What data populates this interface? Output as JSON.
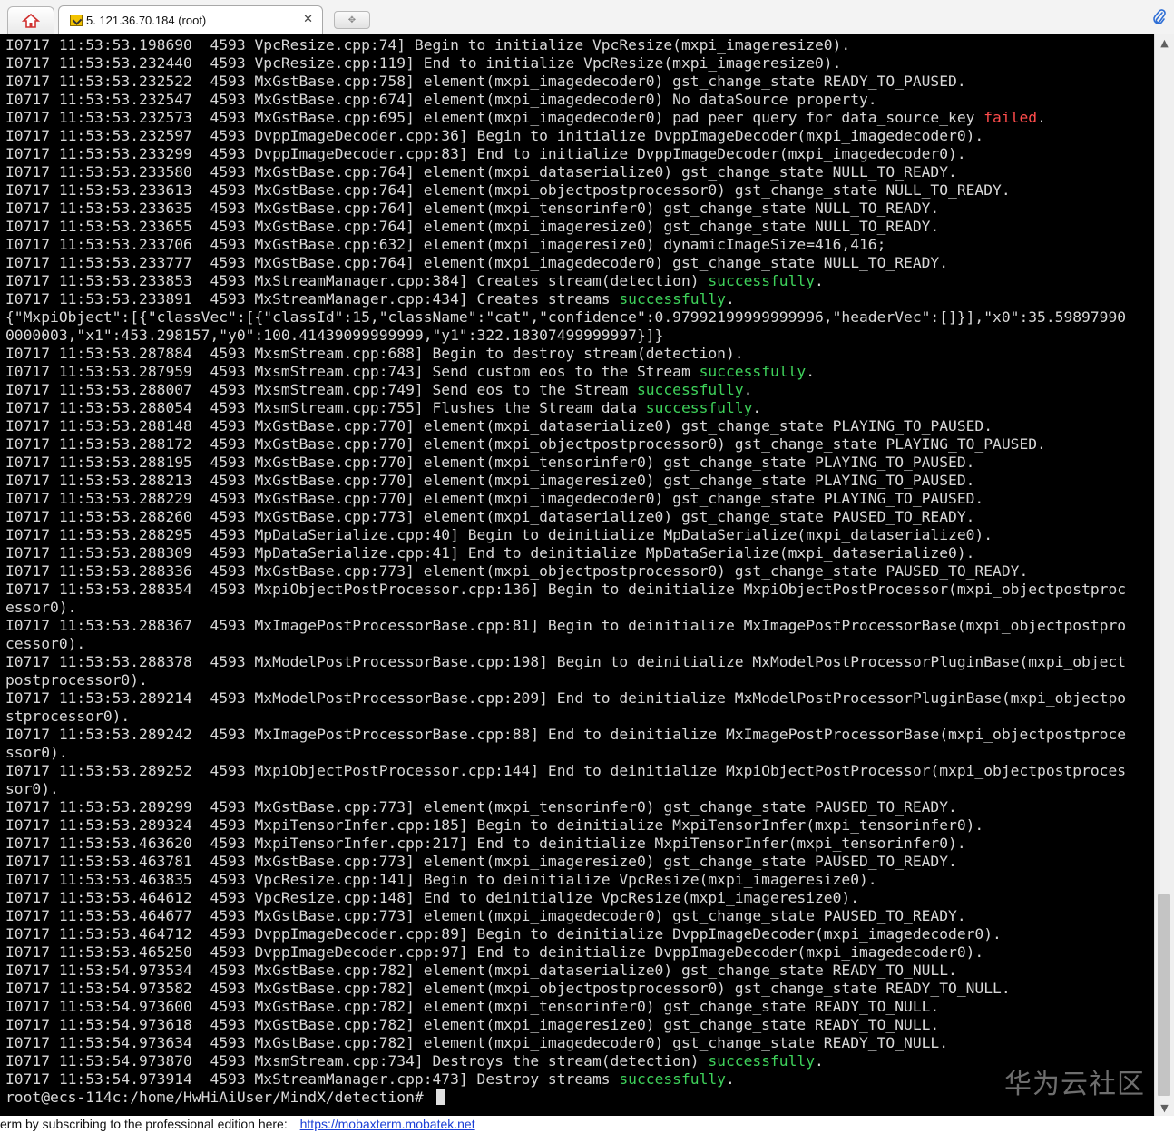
{
  "tabs": {
    "home_icon": "home-icon",
    "session_title": "5. 121.36.70.184 (root)",
    "close_glyph": "✕",
    "new_tab_glyph": "✥",
    "attach_icon": "paperclip-icon"
  },
  "terminal": {
    "lines": [
      [
        {
          "t": "I0717 11:53:53.198690  4593 VpcResize.cpp:74] Begin to initialize VpcResize(mxpi_imageresize0)."
        }
      ],
      [
        {
          "t": "I0717 11:53:53.232440  4593 VpcResize.cpp:119] End to initialize VpcResize(mxpi_imageresize0)."
        }
      ],
      [
        {
          "t": "I0717 11:53:53.232522  4593 MxGstBase.cpp:758] element(mxpi_imagedecoder0) gst_change_state READY_TO_PAUSED."
        }
      ],
      [
        {
          "t": "I0717 11:53:53.232547  4593 MxGstBase.cpp:674] element(mxpi_imagedecoder0) No dataSource property."
        }
      ],
      [
        {
          "t": "I0717 11:53:53.232573  4593 MxGstBase.cpp:695] element(mxpi_imagedecoder0) pad peer query for data_source_key "
        },
        {
          "t": "failed",
          "c": "red"
        },
        {
          "t": "."
        }
      ],
      [
        {
          "t": "I0717 11:53:53.232597  4593 DvppImageDecoder.cpp:36] Begin to initialize DvppImageDecoder(mxpi_imagedecoder0)."
        }
      ],
      [
        {
          "t": "I0717 11:53:53.233299  4593 DvppImageDecoder.cpp:83] End to initialize DvppImageDecoder(mxpi_imagedecoder0)."
        }
      ],
      [
        {
          "t": "I0717 11:53:53.233580  4593 MxGstBase.cpp:764] element(mxpi_dataserialize0) gst_change_state NULL_TO_READY."
        }
      ],
      [
        {
          "t": "I0717 11:53:53.233613  4593 MxGstBase.cpp:764] element(mxpi_objectpostprocessor0) gst_change_state NULL_TO_READY."
        }
      ],
      [
        {
          "t": "I0717 11:53:53.233635  4593 MxGstBase.cpp:764] element(mxpi_tensorinfer0) gst_change_state NULL_TO_READY."
        }
      ],
      [
        {
          "t": "I0717 11:53:53.233655  4593 MxGstBase.cpp:764] element(mxpi_imageresize0) gst_change_state NULL_TO_READY."
        }
      ],
      [
        {
          "t": "I0717 11:53:53.233706  4593 MxGstBase.cpp:632] element(mxpi_imageresize0) dynamicImageSize=416,416;"
        }
      ],
      [
        {
          "t": "I0717 11:53:53.233777  4593 MxGstBase.cpp:764] element(mxpi_imagedecoder0) gst_change_state NULL_TO_READY."
        }
      ],
      [
        {
          "t": "I0717 11:53:53.233853  4593 MxStreamManager.cpp:384] Creates stream(detection) "
        },
        {
          "t": "successfully",
          "c": "green"
        },
        {
          "t": "."
        }
      ],
      [
        {
          "t": "I0717 11:53:53.233891  4593 MxStreamManager.cpp:434] Creates streams "
        },
        {
          "t": "successfully",
          "c": "green"
        },
        {
          "t": "."
        }
      ],
      [
        {
          "t": "{\"MxpiObject\":[{\"classVec\":[{\"classId\":15,\"className\":\"cat\",\"confidence\":0.97992199999999996,\"headerVec\":[]}],\"x0\":35.59897990"
        }
      ],
      [
        {
          "t": "0000003,\"x1\":453.298157,\"y0\":100.41439099999999,\"y1\":322.18307499999997}]}"
        }
      ],
      [
        {
          "t": "I0717 11:53:53.287884  4593 MxsmStream.cpp:688] Begin to destroy stream(detection)."
        }
      ],
      [
        {
          "t": "I0717 11:53:53.287959  4593 MxsmStream.cpp:743] Send custom eos to the Stream "
        },
        {
          "t": "successfully",
          "c": "green"
        },
        {
          "t": "."
        }
      ],
      [
        {
          "t": "I0717 11:53:53.288007  4593 MxsmStream.cpp:749] Send eos to the Stream "
        },
        {
          "t": "successfully",
          "c": "green"
        },
        {
          "t": "."
        }
      ],
      [
        {
          "t": "I0717 11:53:53.288054  4593 MxsmStream.cpp:755] Flushes the Stream data "
        },
        {
          "t": "successfully",
          "c": "green"
        },
        {
          "t": "."
        }
      ],
      [
        {
          "t": "I0717 11:53:53.288148  4593 MxGstBase.cpp:770] element(mxpi_dataserialize0) gst_change_state PLAYING_TO_PAUSED."
        }
      ],
      [
        {
          "t": "I0717 11:53:53.288172  4593 MxGstBase.cpp:770] element(mxpi_objectpostprocessor0) gst_change_state PLAYING_TO_PAUSED."
        }
      ],
      [
        {
          "t": "I0717 11:53:53.288195  4593 MxGstBase.cpp:770] element(mxpi_tensorinfer0) gst_change_state PLAYING_TO_PAUSED."
        }
      ],
      [
        {
          "t": "I0717 11:53:53.288213  4593 MxGstBase.cpp:770] element(mxpi_imageresize0) gst_change_state PLAYING_TO_PAUSED."
        }
      ],
      [
        {
          "t": "I0717 11:53:53.288229  4593 MxGstBase.cpp:770] element(mxpi_imagedecoder0) gst_change_state PLAYING_TO_PAUSED."
        }
      ],
      [
        {
          "t": "I0717 11:53:53.288260  4593 MxGstBase.cpp:773] element(mxpi_dataserialize0) gst_change_state PAUSED_TO_READY."
        }
      ],
      [
        {
          "t": "I0717 11:53:53.288295  4593 MpDataSerialize.cpp:40] Begin to deinitialize MpDataSerialize(mxpi_dataserialize0)."
        }
      ],
      [
        {
          "t": "I0717 11:53:53.288309  4593 MpDataSerialize.cpp:41] End to deinitialize MpDataSerialize(mxpi_dataserialize0)."
        }
      ],
      [
        {
          "t": "I0717 11:53:53.288336  4593 MxGstBase.cpp:773] element(mxpi_objectpostprocessor0) gst_change_state PAUSED_TO_READY."
        }
      ],
      [
        {
          "t": "I0717 11:53:53.288354  4593 MxpiObjectPostProcessor.cpp:136] Begin to deinitialize MxpiObjectPostProcessor(mxpi_objectpostproc"
        }
      ],
      [
        {
          "t": "essor0)."
        }
      ],
      [
        {
          "t": "I0717 11:53:53.288367  4593 MxImagePostProcessorBase.cpp:81] Begin to deinitialize MxImagePostProcessorBase(mxpi_objectpostpro"
        }
      ],
      [
        {
          "t": "cessor0)."
        }
      ],
      [
        {
          "t": "I0717 11:53:53.288378  4593 MxModelPostProcessorBase.cpp:198] Begin to deinitialize MxModelPostProcessorPluginBase(mxpi_object"
        }
      ],
      [
        {
          "t": "postprocessor0)."
        }
      ],
      [
        {
          "t": "I0717 11:53:53.289214  4593 MxModelPostProcessorBase.cpp:209] End to deinitialize MxModelPostProcessorPluginBase(mxpi_objectpo"
        }
      ],
      [
        {
          "t": "stprocessor0)."
        }
      ],
      [
        {
          "t": "I0717 11:53:53.289242  4593 MxImagePostProcessorBase.cpp:88] End to deinitialize MxImagePostProcessorBase(mxpi_objectpostproce"
        }
      ],
      [
        {
          "t": "ssor0)."
        }
      ],
      [
        {
          "t": "I0717 11:53:53.289252  4593 MxpiObjectPostProcessor.cpp:144] End to deinitialize MxpiObjectPostProcessor(mxpi_objectpostproces"
        }
      ],
      [
        {
          "t": "sor0)."
        }
      ],
      [
        {
          "t": "I0717 11:53:53.289299  4593 MxGstBase.cpp:773] element(mxpi_tensorinfer0) gst_change_state PAUSED_TO_READY."
        }
      ],
      [
        {
          "t": "I0717 11:53:53.289324  4593 MxpiTensorInfer.cpp:185] Begin to deinitialize MxpiTensorInfer(mxpi_tensorinfer0)."
        }
      ],
      [
        {
          "t": "I0717 11:53:53.463620  4593 MxpiTensorInfer.cpp:217] End to deinitialize MxpiTensorInfer(mxpi_tensorinfer0)."
        }
      ],
      [
        {
          "t": "I0717 11:53:53.463781  4593 MxGstBase.cpp:773] element(mxpi_imageresize0) gst_change_state PAUSED_TO_READY."
        }
      ],
      [
        {
          "t": "I0717 11:53:53.463835  4593 VpcResize.cpp:141] Begin to deinitialize VpcResize(mxpi_imageresize0)."
        }
      ],
      [
        {
          "t": "I0717 11:53:53.464612  4593 VpcResize.cpp:148] End to deinitialize VpcResize(mxpi_imageresize0)."
        }
      ],
      [
        {
          "t": "I0717 11:53:53.464677  4593 MxGstBase.cpp:773] element(mxpi_imagedecoder0) gst_change_state PAUSED_TO_READY."
        }
      ],
      [
        {
          "t": "I0717 11:53:53.464712  4593 DvppImageDecoder.cpp:89] Begin to deinitialize DvppImageDecoder(mxpi_imagedecoder0)."
        }
      ],
      [
        {
          "t": "I0717 11:53:53.465250  4593 DvppImageDecoder.cpp:97] End to deinitialize DvppImageDecoder(mxpi_imagedecoder0)."
        }
      ],
      [
        {
          "t": "I0717 11:53:54.973534  4593 MxGstBase.cpp:782] element(mxpi_dataserialize0) gst_change_state READY_TO_NULL."
        }
      ],
      [
        {
          "t": "I0717 11:53:54.973582  4593 MxGstBase.cpp:782] element(mxpi_objectpostprocessor0) gst_change_state READY_TO_NULL."
        }
      ],
      [
        {
          "t": "I0717 11:53:54.973600  4593 MxGstBase.cpp:782] element(mxpi_tensorinfer0) gst_change_state READY_TO_NULL."
        }
      ],
      [
        {
          "t": "I0717 11:53:54.973618  4593 MxGstBase.cpp:782] element(mxpi_imageresize0) gst_change_state READY_TO_NULL."
        }
      ],
      [
        {
          "t": "I0717 11:53:54.973634  4593 MxGstBase.cpp:782] element(mxpi_imagedecoder0) gst_change_state READY_TO_NULL."
        }
      ],
      [
        {
          "t": "I0717 11:53:54.973870  4593 MxsmStream.cpp:734] Destroys the stream(detection) "
        },
        {
          "t": "successfully",
          "c": "green"
        },
        {
          "t": "."
        }
      ],
      [
        {
          "t": "I0717 11:53:54.973914  4593 MxStreamManager.cpp:473] Destroy streams "
        },
        {
          "t": "successfully",
          "c": "green"
        },
        {
          "t": "."
        }
      ]
    ],
    "prompt": "root@ecs-114c:/home/HwHiAiUser/MindX/detection# ",
    "watermark": "华为云社区",
    "colors": {
      "background": "#000000",
      "text": "#d8d8d8",
      "success": "#3ed15a",
      "failure": "#ff4c4c"
    }
  },
  "scrollbar": {
    "up_glyph": "▲",
    "down_glyph": "▼",
    "position_fraction": 0.81
  },
  "statusbar": {
    "text": "erm by subscribing to the professional edition here:",
    "link": "https://mobaxterm.mobatek.net"
  }
}
